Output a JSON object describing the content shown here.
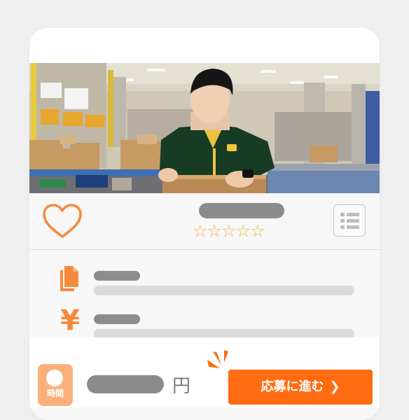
{
  "card": {
    "rating_stars": "☆☆☆☆☆",
    "icons": [
      "heart-icon",
      "list-icon",
      "document-icon",
      "yen-icon",
      "clock-icon",
      "chevron-right-icon"
    ]
  },
  "details": {
    "yen_symbol": "¥"
  },
  "bottom_bar": {
    "time_label": "時間",
    "currency_unit": "円",
    "apply_button_label": "応募に進む",
    "apply_button_chevron": "❯"
  },
  "colors": {
    "accent_orange": "#ff6c11",
    "icon_orange": "#f58a3e",
    "badge_orange": "#fbb07a",
    "star_gold": "#f0b43c",
    "placeholder_dark": "#8c8c8c",
    "placeholder_light": "#dadada"
  }
}
